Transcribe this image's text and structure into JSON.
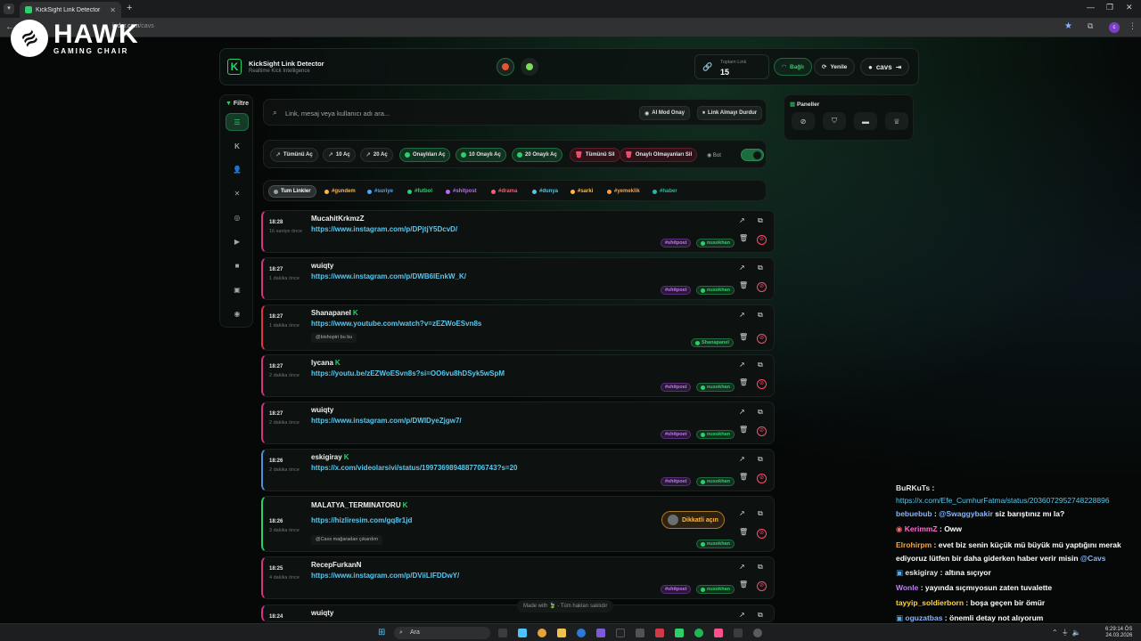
{
  "browser": {
    "tab_title": "KickSight Link Detector",
    "url_host": "inder.com",
    "url_path": "/cavs",
    "profile_initial": "c"
  },
  "overlay": {
    "brand": "HAWK",
    "sub": "GAMING CHAIR"
  },
  "header": {
    "title": "KickSight Link Detector",
    "subtitle": "Realtime Kick Intelligence",
    "total_label": "Toplam Link",
    "total_count": "15",
    "connected_label": "Bağlı",
    "refresh_label": "Yenile",
    "user": "cavs"
  },
  "filter": {
    "label": "Filtre",
    "icons": [
      "list-icon",
      "kick-icon",
      "user-icon",
      "x-icon",
      "instagram-icon",
      "youtube-icon",
      "camera-icon",
      "photo-icon",
      "globe-icon"
    ]
  },
  "search": {
    "placeholder": "Link, mesaj veya kullanıcı adı ara...",
    "ai_label": "AI Mod Onay",
    "stop_label": "Link Almayı Durdur"
  },
  "actions": {
    "open_all": "Tümünü Aç",
    "open10": "10 Aç",
    "open20": "20 Aç",
    "open_approved": "Onaylıları Aç",
    "open10_approved": "10 Onaylı Aç",
    "open20_approved": "20 Onaylı Aç",
    "delete_all": "Tümünü Sil",
    "delete_unapproved": "Onaylı Olmayanları Sil",
    "bot_label": "Bot"
  },
  "tags": [
    {
      "label": "Tum Linkler",
      "color": "#9aa3a0"
    },
    {
      "label": "#gundem",
      "color": "#ffb547"
    },
    {
      "label": "#suriye",
      "color": "#4ea7ff"
    },
    {
      "label": "#futbol",
      "color": "#2ad068"
    },
    {
      "label": "#shitpost",
      "color": "#b86cf0"
    },
    {
      "label": "#drama",
      "color": "#ff5a6e"
    },
    {
      "label": "#dunya",
      "color": "#4ec9e8"
    },
    {
      "label": "#sarki",
      "color": "#ffb547"
    },
    {
      "label": "#yemeklik",
      "color": "#ff9f43"
    },
    {
      "label": "#haber",
      "color": "#2ab8a0"
    }
  ],
  "panels": {
    "title": "Paneller",
    "icons": [
      "block-icon",
      "shield-icon",
      "archive-icon",
      "trophy-icon"
    ]
  },
  "links": [
    {
      "time": "18:28",
      "ago": "16 saniye önce",
      "user": "MucahitKrkmzZ",
      "verified": false,
      "url": "https://www.instagram.com/p/DPjtjY5DcvD/",
      "note": "",
      "category": "#shitpost",
      "owner": "nusokhan",
      "accent": "#d63384"
    },
    {
      "time": "18:27",
      "ago": "1 dakika önce",
      "user": "wuiqty",
      "verified": false,
      "url": "https://www.instagram.com/p/DWB6lEnkW_K/",
      "note": "",
      "category": "#shitpost",
      "owner": "nusokhan",
      "accent": "#d63384"
    },
    {
      "time": "18:27",
      "ago": "1 dakika önce",
      "user": "Shanapanel",
      "verified": true,
      "url": "https://www.youtube.com/watch?v=zEZWoESvn8s",
      "note": "@bishopiri bu bu",
      "category": "",
      "owner": "Shanapanel",
      "accent": "#e0334a"
    },
    {
      "time": "18:27",
      "ago": "2 dakika önce",
      "user": "lycana",
      "verified": true,
      "url": "https://youtu.be/zEZWoESvn8s?si=OO6vu8hDSyk5wSpM",
      "note": "",
      "category": "#shitpost",
      "owner": "nusokhan",
      "accent": "#d63384"
    },
    {
      "time": "18:27",
      "ago": "2 dakika önce",
      "user": "wuiqty",
      "verified": false,
      "url": "https://www.instagram.com/p/DWIDyeZjgw7/",
      "note": "",
      "category": "#shitpost",
      "owner": "nusokhan",
      "accent": "#d63384"
    },
    {
      "time": "18:26",
      "ago": "2 dakika önce",
      "user": "eskigiray",
      "verified": true,
      "url": "https://x.com/videolarsivi/status/1997369894887706743?s=20",
      "note": "",
      "category": "#shitpost",
      "owner": "nusokhan",
      "accent": "#4e8fe0"
    },
    {
      "time": "18:26",
      "ago": "3 dakika önce",
      "user": "MALATYA_TERMINATORU",
      "verified": true,
      "url": "https://hizliresim.com/gq8r1jd",
      "note": "@Cavs mağaradan çıkardım",
      "category": "",
      "owner": "nusokhan",
      "accent": "#2ad068",
      "warning": "Dikkatli açın"
    },
    {
      "time": "18:25",
      "ago": "4 dakika önce",
      "user": "RecepFurkanN",
      "verified": false,
      "url": "https://www.instagram.com/p/DViiLIFDDwY/",
      "note": "",
      "category": "#shitpost",
      "owner": "nusokhan",
      "accent": "#d63384"
    },
    {
      "time": "18:24",
      "ago": "",
      "user": "wuiqty",
      "verified": false,
      "url": "",
      "note": "",
      "category": "",
      "owner": "",
      "accent": "#d63384"
    }
  ],
  "footer": "Made with 🍃 - Tüm hakları saklıdır",
  "chat": [
    {
      "user": "BuRKuTs",
      "color": "#e6e6e6",
      "badge": "",
      "msg": "https://x.com/Efe_CumhurFatma/status/2036072952748228896",
      "type": "link"
    },
    {
      "user": "bebuebub",
      "color": "#8ab4f8",
      "badge": "",
      "msg": "@Swaggybakir siz barıştınız mı la?",
      "type": "text"
    },
    {
      "user": "KerimmZ",
      "color": "#ff6ad5",
      "badge": "sub",
      "msg": "Oww",
      "type": "text"
    },
    {
      "user": "Elrohirpm",
      "color": "#f7a440",
      "badge": "",
      "msg": "evet biz senin küçük mü büyük mü yaptığını merak ediyoruz lütfen bir daha giderken haber verir misin @Cavs",
      "type": "text"
    },
    {
      "user": "eskigiray",
      "color": "#e6e6e6",
      "badge": "mod",
      "msg": "altına sıçıyor",
      "type": "text"
    },
    {
      "user": "Wonle",
      "color": "#c17ef5",
      "badge": "",
      "msg": "yayında sıçmıyosun zaten tuvalette",
      "type": "text"
    },
    {
      "user": "tayyip_soldierborn",
      "color": "#ffd43b",
      "badge": "",
      "msg": "boşa geçen bir ömür",
      "type": "text"
    },
    {
      "user": "oguzatbas",
      "color": "#8ab4f8",
      "badge": "mod",
      "msg": "önemli detay not alıyorum",
      "type": "text"
    }
  ],
  "taskbar": {
    "search_label": "Ara",
    "time": "6:29:14 ÖS",
    "date": "24.03.2026"
  }
}
